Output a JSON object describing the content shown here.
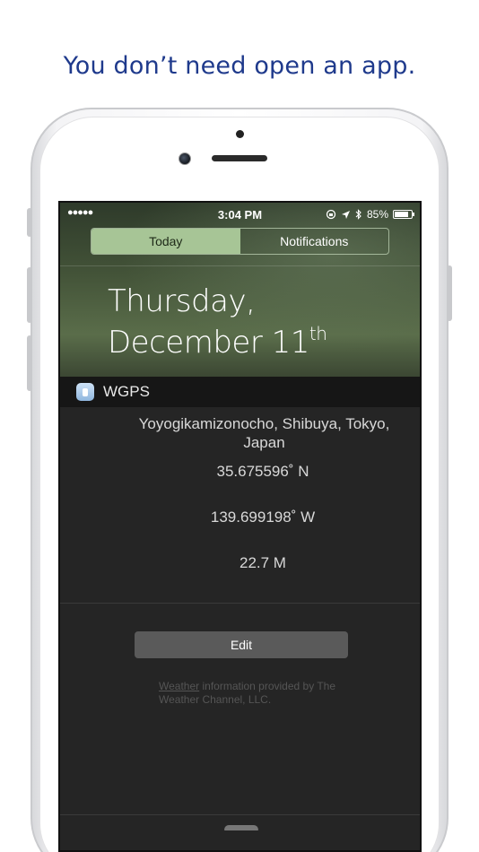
{
  "headline": "You don’t need open an app.",
  "status_bar": {
    "signal": "●●●●●",
    "time": "3:04 PM",
    "icons": [
      "rotation-lock-icon",
      "location-arrow-icon",
      "bluetooth-icon"
    ],
    "battery_percent": "85%",
    "battery_level": 0.85
  },
  "tabs": [
    {
      "label": "Today",
      "active": true
    },
    {
      "label": "Notifications",
      "active": false
    }
  ],
  "date": {
    "weekday": "Thursday,",
    "month_day": "December 11",
    "suffix": "th"
  },
  "widget": {
    "name": "WGPS",
    "address": "Yoyogikamizonocho, Shibuya, Tokyo, Japan",
    "latitude": "35.675596˚ N",
    "longitude": "139.699198˚ W",
    "altitude": "22.7 M"
  },
  "edit_label": "Edit",
  "footer": {
    "link": "Weather",
    "text": " information provided by The Weather Channel, LLC."
  },
  "colors": {
    "headline": "#1f3a8c",
    "tab_active": "#a7c596"
  }
}
